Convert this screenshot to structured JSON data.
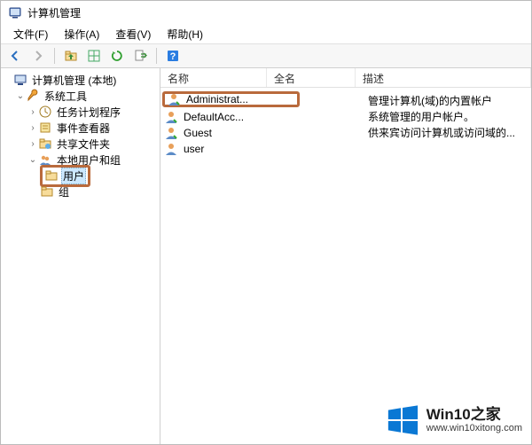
{
  "window": {
    "title": "计算机管理"
  },
  "menu": {
    "file": "文件(F)",
    "action": "操作(A)",
    "view": "查看(V)",
    "help": "帮助(H)"
  },
  "toolbar_icons": {
    "back": "back-icon",
    "forward": "forward-icon",
    "up": "up-icon",
    "properties": "properties-icon",
    "refresh": "refresh-icon",
    "export": "export-icon",
    "help": "help-icon"
  },
  "tree": {
    "root": "计算机管理 (本地)",
    "system_tools": "系统工具",
    "task_scheduler": "任务计划程序",
    "event_viewer": "事件查看器",
    "shared_folders": "共享文件夹",
    "local_users_groups": "本地用户和组",
    "users": "用户",
    "groups": "组"
  },
  "columns": {
    "name": "名称",
    "fullname": "全名",
    "description": "描述"
  },
  "users": [
    {
      "name": "Administrat...",
      "desc": "管理计算机(域)的内置帐户"
    },
    {
      "name": "DefaultAcc...",
      "desc": "系统管理的用户帐户。"
    },
    {
      "name": "Guest",
      "desc": "供来宾访问计算机或访问域的..."
    },
    {
      "name": "user",
      "desc": ""
    }
  ],
  "watermark": {
    "brand": "Win10之家",
    "url": "www.win10xitong.com"
  }
}
